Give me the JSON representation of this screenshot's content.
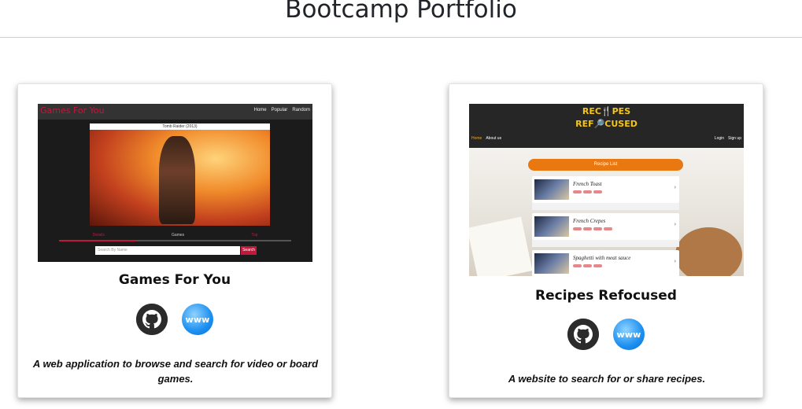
{
  "header": {
    "title": "Bootcamp Portfolio"
  },
  "projects": [
    {
      "title": "Games For You",
      "description": "A web application to browse and search for video or board games.",
      "github_icon": "github-icon",
      "website_icon": "www-globe-icon",
      "website_label": "www",
      "screenshot": {
        "brand": "Games For You",
        "nav": [
          "Home",
          "Popular",
          "Random"
        ],
        "featured_title": "Tomb Raider (2013)",
        "tabs": [
          "Details",
          "Games",
          "Top"
        ],
        "search_placeholder": "Search By Name",
        "search_button": "Search"
      }
    },
    {
      "title": "Recipes Refocused",
      "description": "A website to search for or share recipes.",
      "github_icon": "github-icon",
      "website_icon": "www-globe-icon",
      "website_label": "www",
      "screenshot": {
        "logo_line1": "REC🍴PES",
        "logo_line2": "REF🔎CUSED",
        "nav_left": [
          "Home",
          "About us"
        ],
        "nav_right": [
          "Login",
          "Sign up"
        ],
        "list_title": "Recipe List",
        "recipes": [
          "French Toast",
          "French Crepes",
          "Spaghetti with meat sauce"
        ]
      }
    }
  ],
  "colors": {
    "accent_red": "#c2183c",
    "recipe_orange": "#e8780f",
    "logo_yellow": "#f5c518",
    "globe_blue": "#1c8ff0"
  }
}
